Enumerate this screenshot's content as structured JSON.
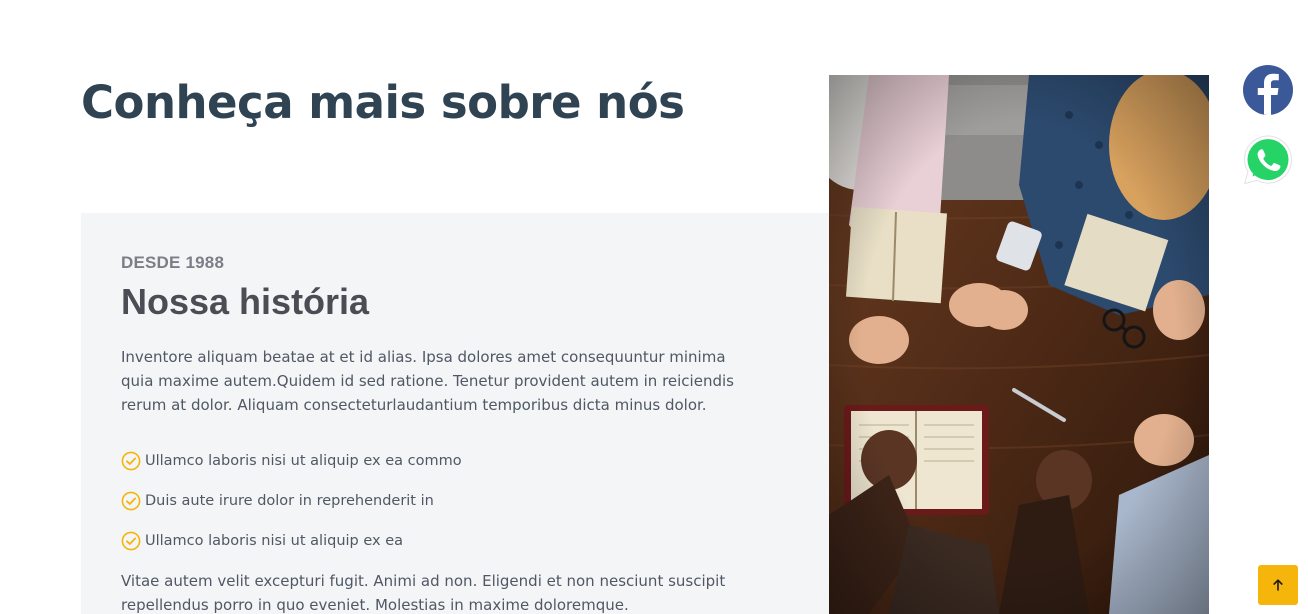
{
  "section": {
    "title": "Conheça mais sobre nós"
  },
  "story": {
    "eyebrow": "DESDE 1988",
    "heading": "Nossa história",
    "paragraph_1": "Inventore aliquam beatae at et id alias. Ipsa dolores amet consequuntur minima quia maxime autem.Quidem id sed ratione. Tenetur provident autem in reiciendis rerum at dolor. Aliquam consecteturlaudantium temporibus dicta minus dolor.",
    "checklist": [
      {
        "icon": "check-circle-icon",
        "text": "Ullamco laboris nisi ut aliquip ex ea commo"
      },
      {
        "icon": "check-circle-icon",
        "text": "Duis aute irure dolor in reprehenderit in"
      },
      {
        "icon": "check-circle-icon",
        "text": "Ullamco laboris nisi ut aliquip ex ea"
      }
    ],
    "paragraph_2": "Vitae autem velit excepturi fugit. Animi ad non. Eligendi et non nesciunt suscipit repellendus porro in quo eveniet. Molestias in maxime doloremque."
  },
  "image": {
    "subject": "group-praying-photo"
  },
  "social": {
    "facebook_icon": "facebook-icon",
    "whatsapp_icon": "whatsapp-icon"
  },
  "back_to_top": {
    "icon": "arrow-up-icon"
  },
  "colors": {
    "title": "#2f4353",
    "card_background": "#f4f5f7",
    "accent_yellow": "#f5b50a",
    "facebook_blue": "#3b5998",
    "whatsapp_green": "#25d366"
  }
}
